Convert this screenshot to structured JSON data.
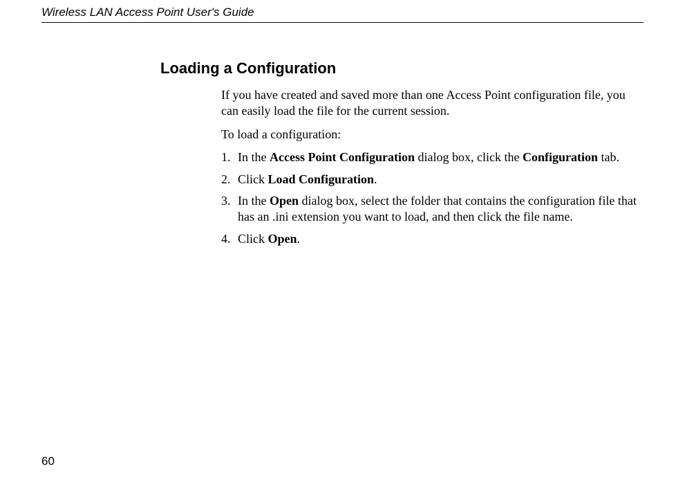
{
  "header": {
    "title": "Wireless LAN Access Point User's Guide"
  },
  "section": {
    "heading": "Loading a Configuration",
    "intro": "If you have created and saved more than one Access Point configuration file, you can easily load the file for the current session.",
    "lead": "To load a configuration:",
    "steps": [
      {
        "num": "1.",
        "parts": [
          {
            "t": "In the ",
            "b": false
          },
          {
            "t": "Access Point Configuration",
            "b": true
          },
          {
            "t": " dialog box, click the ",
            "b": false
          },
          {
            "t": "Configuration",
            "b": true
          },
          {
            "t": " tab.",
            "b": false
          }
        ]
      },
      {
        "num": "2.",
        "parts": [
          {
            "t": "Click ",
            "b": false
          },
          {
            "t": "Load Configuration",
            "b": true
          },
          {
            "t": ".",
            "b": false
          }
        ]
      },
      {
        "num": "3.",
        "parts": [
          {
            "t": "In the ",
            "b": false
          },
          {
            "t": "Open",
            "b": true
          },
          {
            "t": " dialog box, select the folder that contains the configuration file that has an .ini extension you want to load, and then click the file name.",
            "b": false
          }
        ]
      },
      {
        "num": "4.",
        "parts": [
          {
            "t": "Click ",
            "b": false
          },
          {
            "t": "Open",
            "b": true
          },
          {
            "t": ".",
            "b": false
          }
        ]
      }
    ]
  },
  "page_number": "60"
}
